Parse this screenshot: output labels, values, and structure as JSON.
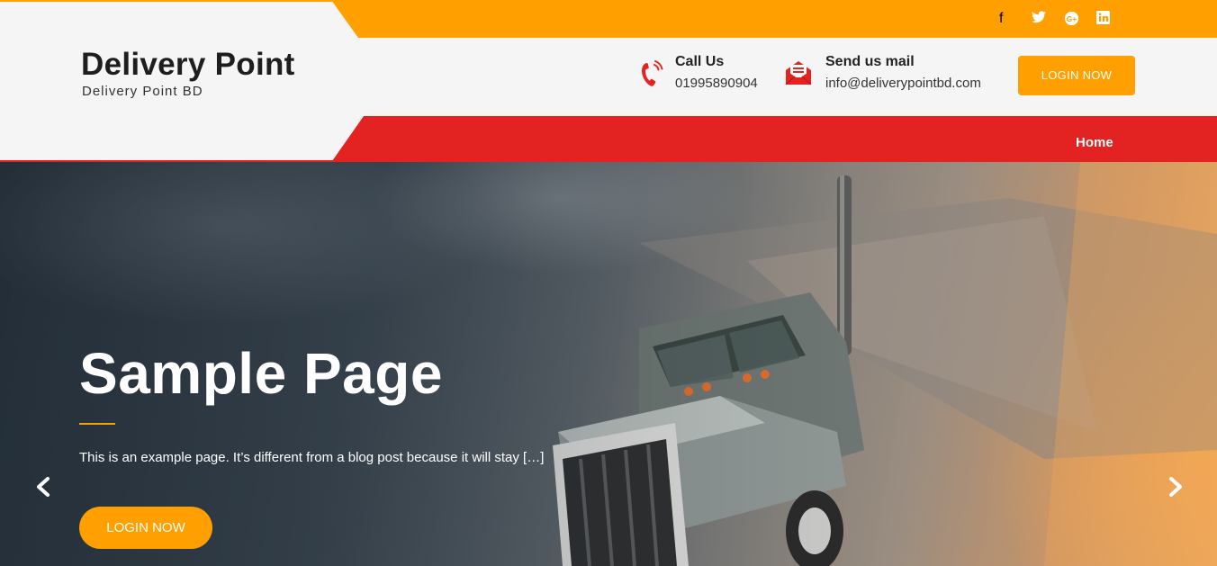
{
  "social": {
    "icons": [
      "facebook-icon",
      "twitter-icon",
      "google-plus-icon",
      "linkedin-icon"
    ],
    "glyphs": [
      "f",
      "t",
      "G+",
      "in"
    ]
  },
  "brand": {
    "title": "Delivery Point",
    "subtitle": "Delivery Point BD"
  },
  "contacts": {
    "call": {
      "title": "Call Us",
      "value": "01995890904",
      "icon": "phone-icon"
    },
    "mail": {
      "title": "Send us mail",
      "value": "info@deliverypointbd.com",
      "icon": "mail-icon"
    }
  },
  "header": {
    "login_label": "LOGIN NOW"
  },
  "nav": {
    "home_label": "Home"
  },
  "hero": {
    "title": "Sample Page",
    "text": "This is an example page. It’s different from a blog post because it will stay […]",
    "button_label": "LOGIN NOW",
    "prev_glyph": "‹",
    "next_glyph": "›"
  },
  "colors": {
    "accent": "#ff9f00",
    "nav": "#e32222",
    "header_bg": "#f5f5f5"
  }
}
